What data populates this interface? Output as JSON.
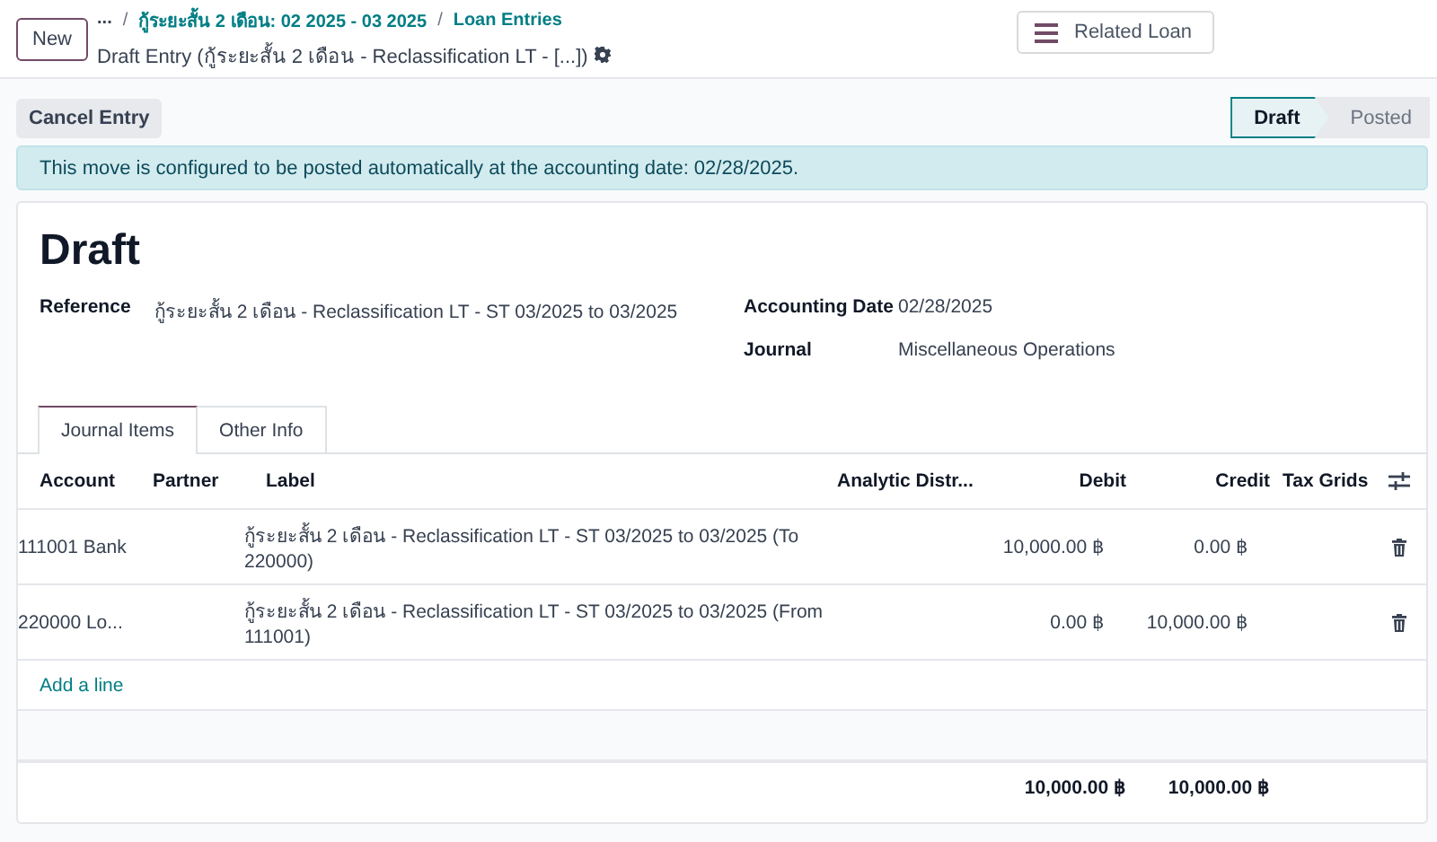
{
  "control_panel": {
    "new_button": "New",
    "more": "...",
    "separator": "/",
    "breadcrumbs": [
      "กู้ระยะสั้น 2 เดือน: 02 2025 - 03 2025",
      "Loan Entries"
    ],
    "current": "Draft Entry (กู้ระยะสั้น 2 เดือน - Reclassification LT - [...])",
    "smart_button": "Related Loan"
  },
  "actions": [
    "Cancel Entry"
  ],
  "status_steps": [
    {
      "label": "Draft",
      "selected": true
    },
    {
      "label": "Posted",
      "selected": false
    }
  ],
  "alert": "This move is configured to be posted automatically at the accounting date: 02/28/2025.",
  "sheet": {
    "title": "Draft",
    "fields_left": [
      {
        "label": "Reference",
        "value": "กู้ระยะสั้น 2 เดือน - Reclassification LT - ST 03/2025 to 03/2025"
      }
    ],
    "fields_right": [
      {
        "label": "Accounting Date",
        "value": "02/28/2025"
      },
      {
        "label": "Journal",
        "value": "Miscellaneous Operations"
      }
    ],
    "tabs": [
      {
        "label": "Journal Items",
        "selected": true
      },
      {
        "label": "Other Info",
        "selected": false
      }
    ],
    "table": {
      "columns": [
        "Account",
        "Partner",
        "Label",
        "Analytic Distr...",
        "Debit",
        "Credit",
        "Tax Grids"
      ],
      "rows": [
        {
          "account": "111001 Bank",
          "label": "กู้ระยะสั้น 2 เดือน - Reclassification LT - ST 03/2025 to 03/2025 (To 220000)",
          "debit": "10,000.00 ฿",
          "credit": "0.00 ฿"
        },
        {
          "account": "220000 Lo...",
          "label": "กู้ระยะสั้น 2 เดือน - Reclassification LT - ST 03/2025 to 03/2025 (From 111001)",
          "debit": "0.00 ฿",
          "credit": "10,000.00 ฿"
        }
      ],
      "add_line": "Add a line",
      "totals": {
        "debit": "10,000.00 ฿",
        "credit": "10,000.00 ฿"
      }
    }
  }
}
